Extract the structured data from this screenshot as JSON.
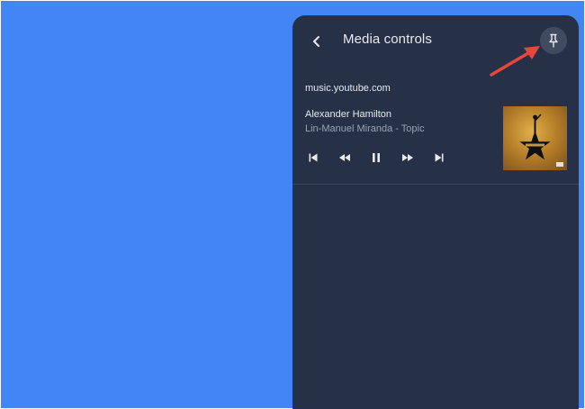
{
  "panel": {
    "title": "Media controls"
  },
  "media": {
    "source": "music.youtube.com",
    "title": "Alexander Hamilton",
    "artist": "Lin-Manuel Miranda - Topic"
  },
  "icons": {
    "back": "chevron-left-icon",
    "pin": "pin-icon",
    "previous": "skip-previous-icon",
    "rewind": "rewind-icon",
    "pause": "pause-icon",
    "forward": "fast-forward-icon",
    "next": "skip-next-icon"
  },
  "colors": {
    "desktop": "#4285f4",
    "panel": "#263148",
    "annotation": "#e8463a"
  }
}
